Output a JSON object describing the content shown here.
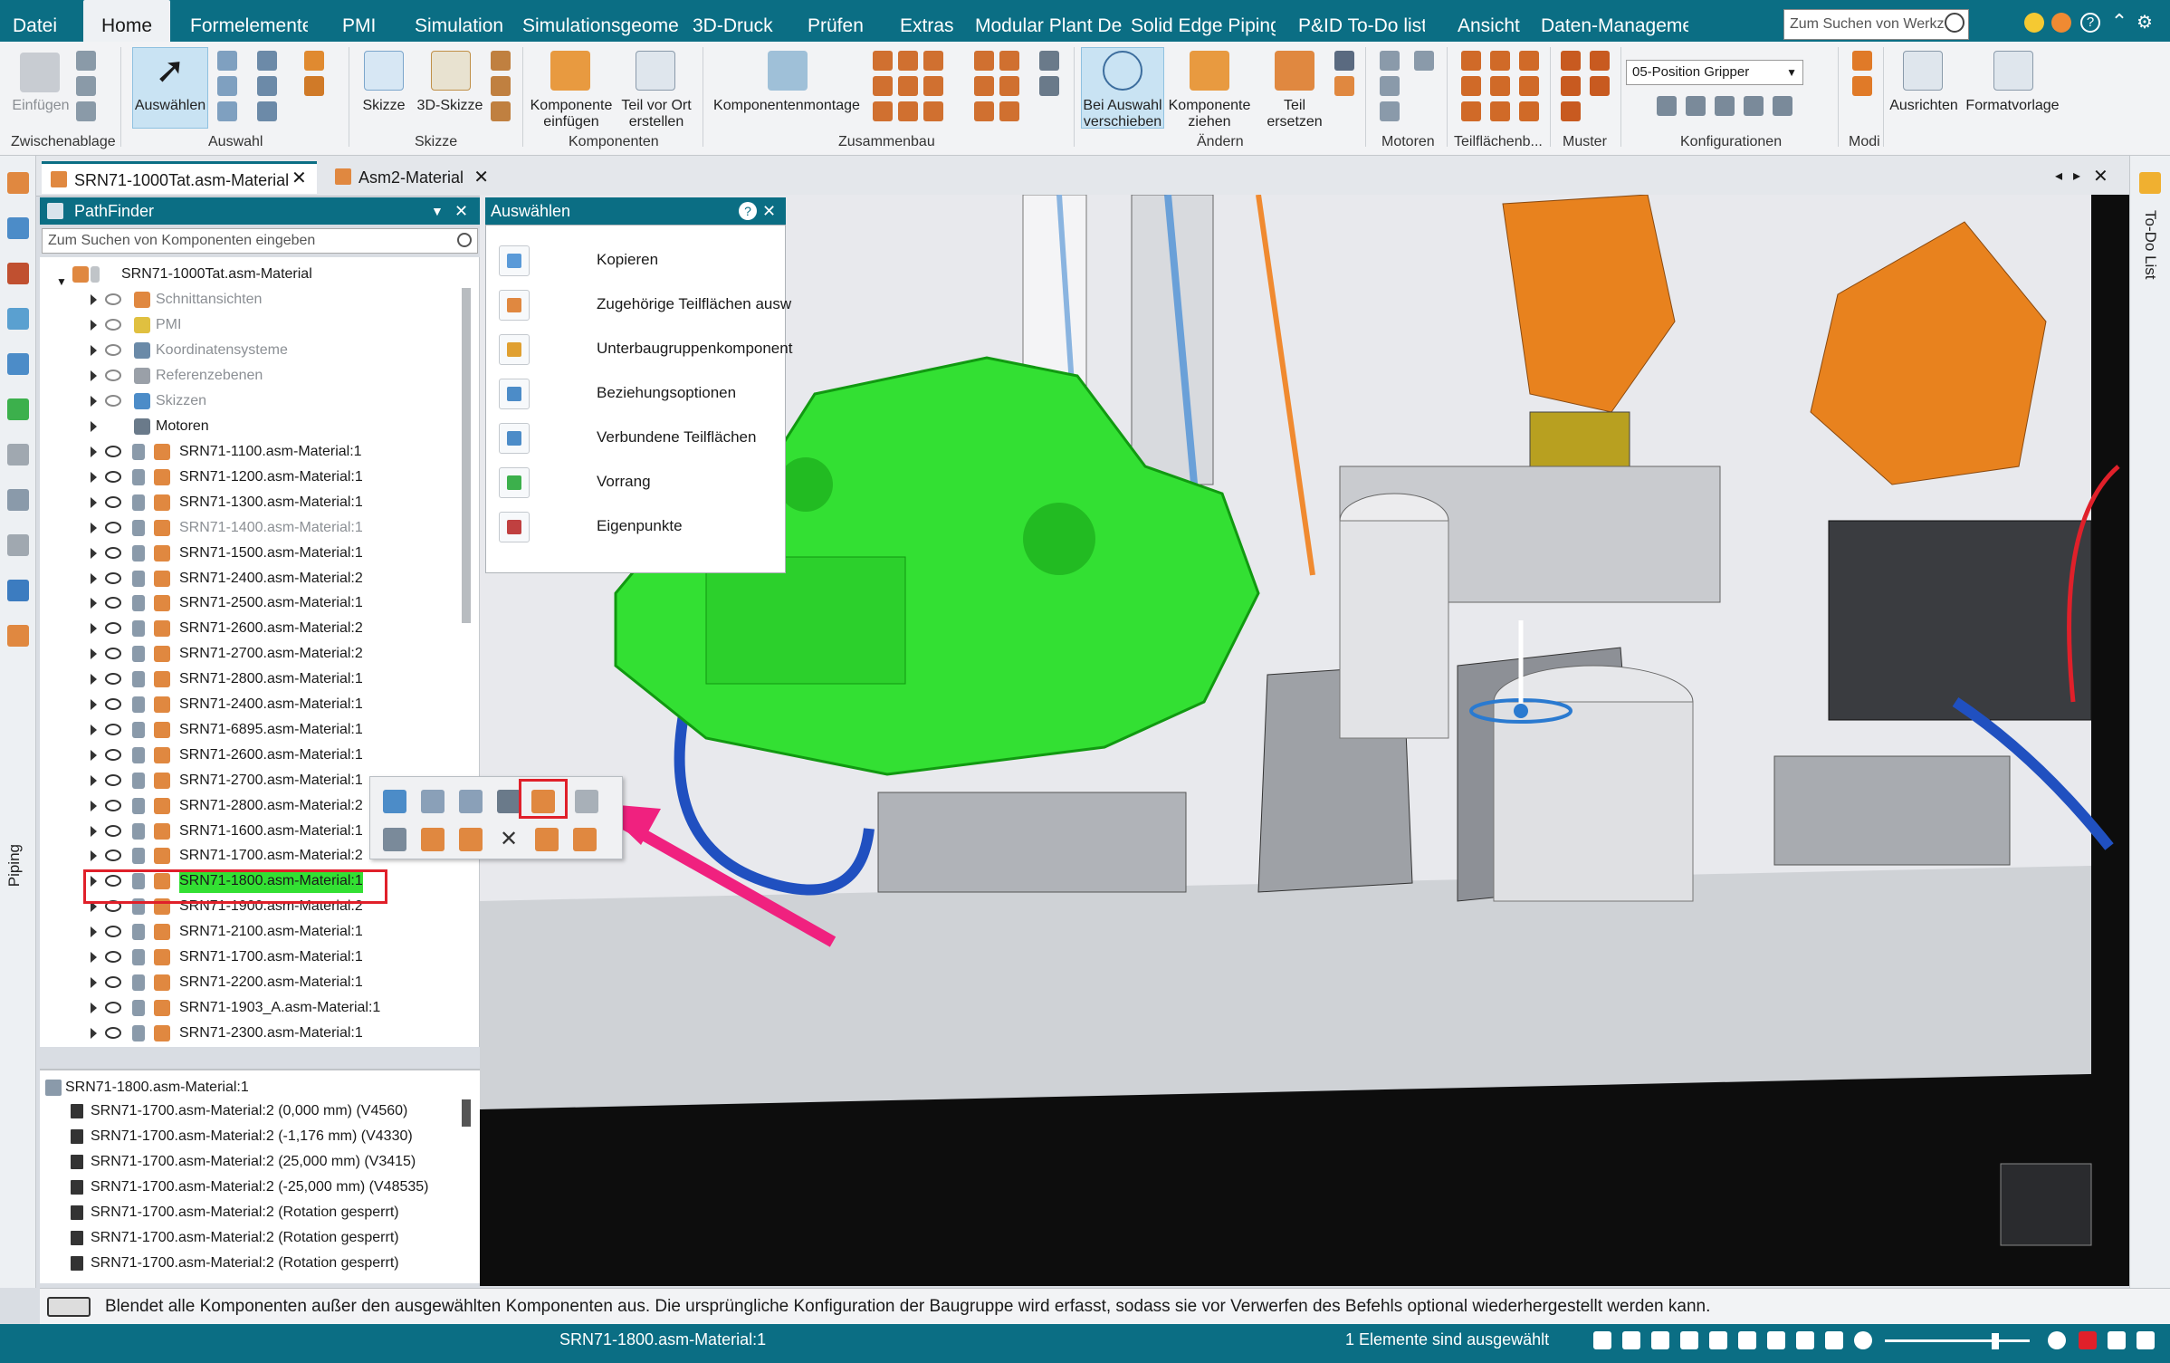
{
  "menu": {
    "items": [
      "Datei",
      "Home",
      "Formelemente",
      "PMI",
      "Simulation",
      "Simulationsgeome",
      "3D-Druck",
      "Prüfen",
      "Extras",
      "Modular Plant Des",
      "Solid Edge Piping",
      "P&ID To-Do list",
      "Ansicht",
      "Daten-Manageme"
    ],
    "active": "Home",
    "search_placeholder": "Zum Suchen von Werkz"
  },
  "ribbon": {
    "groups": {
      "clipboard": "Zwischenablage",
      "select": "Auswahl",
      "sketch": "Skizze",
      "components": "Komponenten",
      "assemble": "Zusammenbau",
      "modify": "Ändern",
      "motors": "Motoren",
      "faces": "Teilflächenb...",
      "pattern": "Muster",
      "configurations": "Konfigurationen",
      "modi": "Modi"
    },
    "buttons": {
      "paste": "Einfügen",
      "select": "Auswählen",
      "sketch": "Skizze",
      "sketch3d": "3D-Skizze",
      "insert_comp_1": "Komponente",
      "insert_comp_2": "einfügen",
      "create_part_1": "Teil vor Ort",
      "create_part_2": "erstellen",
      "comp_assembly": "Komponentenmontage",
      "move_sel_1": "Bei Auswahl",
      "move_sel_2": "verschieben",
      "drag_comp_1": "Komponente",
      "drag_comp_2": "ziehen",
      "replace_1": "Teil",
      "replace_2": "ersetzen",
      "align": "Ausrichten",
      "style": "Formatvorlage"
    },
    "config_value": "05-Position Gripper"
  },
  "doc_tabs": [
    {
      "label": "SRN71-1000Tat.asm-Material"
    },
    {
      "label": "Asm2-Material"
    }
  ],
  "pathfinder": {
    "title": "PathFinder",
    "search_placeholder": "Zum Suchen von Komponenten eingeben",
    "root": "SRN71-1000Tat.asm-Material",
    "groups": [
      "Schnittansichten",
      "PMI",
      "Koordinatensysteme",
      "Referenzebenen",
      "Skizzen",
      "Motoren"
    ],
    "items": [
      {
        "label": "SRN71-1100.asm-Material:1",
        "dim": false
      },
      {
        "label": "SRN71-1200.asm-Material:1",
        "dim": false
      },
      {
        "label": "SRN71-1300.asm-Material:1",
        "dim": false
      },
      {
        "label": "SRN71-1400.asm-Material:1",
        "dim": true
      },
      {
        "label": "SRN71-1500.asm-Material:1",
        "dim": false
      },
      {
        "label": "SRN71-2400.asm-Material:2",
        "dim": false
      },
      {
        "label": "SRN71-2500.asm-Material:1",
        "dim": false
      },
      {
        "label": "SRN71-2600.asm-Material:2",
        "dim": false
      },
      {
        "label": "SRN71-2700.asm-Material:2",
        "dim": false
      },
      {
        "label": "SRN71-2800.asm-Material:1",
        "dim": false
      },
      {
        "label": "SRN71-2400.asm-Material:1",
        "dim": false
      },
      {
        "label": "SRN71-6895.asm-Material:1",
        "dim": false
      },
      {
        "label": "SRN71-2600.asm-Material:1",
        "dim": false
      },
      {
        "label": "SRN71-2700.asm-Material:1",
        "dim": false
      },
      {
        "label": "SRN71-2800.asm-Material:2",
        "dim": false
      },
      {
        "label": "SRN71-1600.asm-Material:1",
        "dim": false
      },
      {
        "label": "SRN71-1700.asm-Material:2",
        "dim": false
      },
      {
        "label": "SRN71-1800.asm-Material:1",
        "dim": false,
        "selected": true
      },
      {
        "label": "SRN71-1900.asm-Material:2",
        "dim": false
      },
      {
        "label": "SRN71-2100.asm-Material:1",
        "dim": false
      },
      {
        "label": "SRN71-1700.asm-Material:1",
        "dim": false
      },
      {
        "label": "SRN71-2200.asm-Material:1",
        "dim": false
      },
      {
        "label": "SRN71-1903_A.asm-Material:1",
        "dim": false
      },
      {
        "label": "SRN71-2300.asm-Material:1",
        "dim": false
      }
    ]
  },
  "relations": {
    "header": "SRN71-1800.asm-Material:1",
    "rows": [
      {
        "label": "SRN71-1700.asm-Material:2  (0,000 mm)  (V4560)"
      },
      {
        "label": "SRN71-1700.asm-Material:2  (-1,176 mm)  (V4330)"
      },
      {
        "label": "SRN71-1700.asm-Material:2  (25,000 mm)  (V3415)"
      },
      {
        "label": "SRN71-1700.asm-Material:2  (-25,000 mm)  (V48535)"
      },
      {
        "label": "SRN71-1700.asm-Material:2  (Rotation gesperrt)"
      },
      {
        "label": "SRN71-1700.asm-Material:2  (Rotation gesperrt)"
      },
      {
        "label": "SRN71-1700.asm-Material:2  (Rotation gesperrt)"
      }
    ]
  },
  "select_panel": {
    "title": "Auswählen",
    "items": [
      "Kopieren",
      "Zugehörige Teilflächen ausw",
      "Unterbaugruppenkomponent",
      "Beziehungsoptionen",
      "Verbundene Teilflächen",
      "Vorrang",
      "Eigenpunkte"
    ]
  },
  "side_labels": {
    "todo": "To-Do List",
    "piping": "Piping"
  },
  "hint": "Blendet alle Komponenten außer den ausgewählten Komponenten aus. Die ursprüngliche Konfiguration der Baugruppe wird erfasst, sodass sie vor Verwerfen des Befehls optional wiederhergestellt werden kann.",
  "status": {
    "active_doc": "SRN71-1800.asm-Material:1",
    "selection": "1 Elemente sind ausgewählt"
  },
  "colors": {
    "accent": "#0b6e84",
    "selection_green": "#33e033",
    "robot_orange": "#e8821e",
    "highlight_red": "#e0202a",
    "arrow_pink": "#f0217f"
  }
}
